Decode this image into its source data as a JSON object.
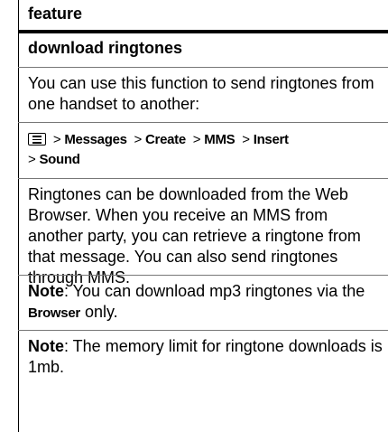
{
  "header": {
    "title": "feature"
  },
  "section": {
    "title": "download ringtones",
    "intro": "You can use this function to send ringtones from one handset to another:",
    "path": {
      "items": [
        "Messages",
        "Create",
        "MMS",
        "Insert",
        "Sound"
      ],
      "separator": ">",
      "icon": "menu-key-icon"
    },
    "body": "Ringtones can be downloaded from the Web Browser. When you receive an MMS from another party, you can retrieve a ringtone from that message. You can also send ringtones through MMS.",
    "note1": {
      "label": "Note",
      "text_before": ": You can download mp3 ringtones via the ",
      "emph": "Browser",
      "text_after": " only."
    },
    "note2": {
      "label": "Note",
      "text": ": The memory limit for ringtone downloads is 1mb."
    }
  }
}
